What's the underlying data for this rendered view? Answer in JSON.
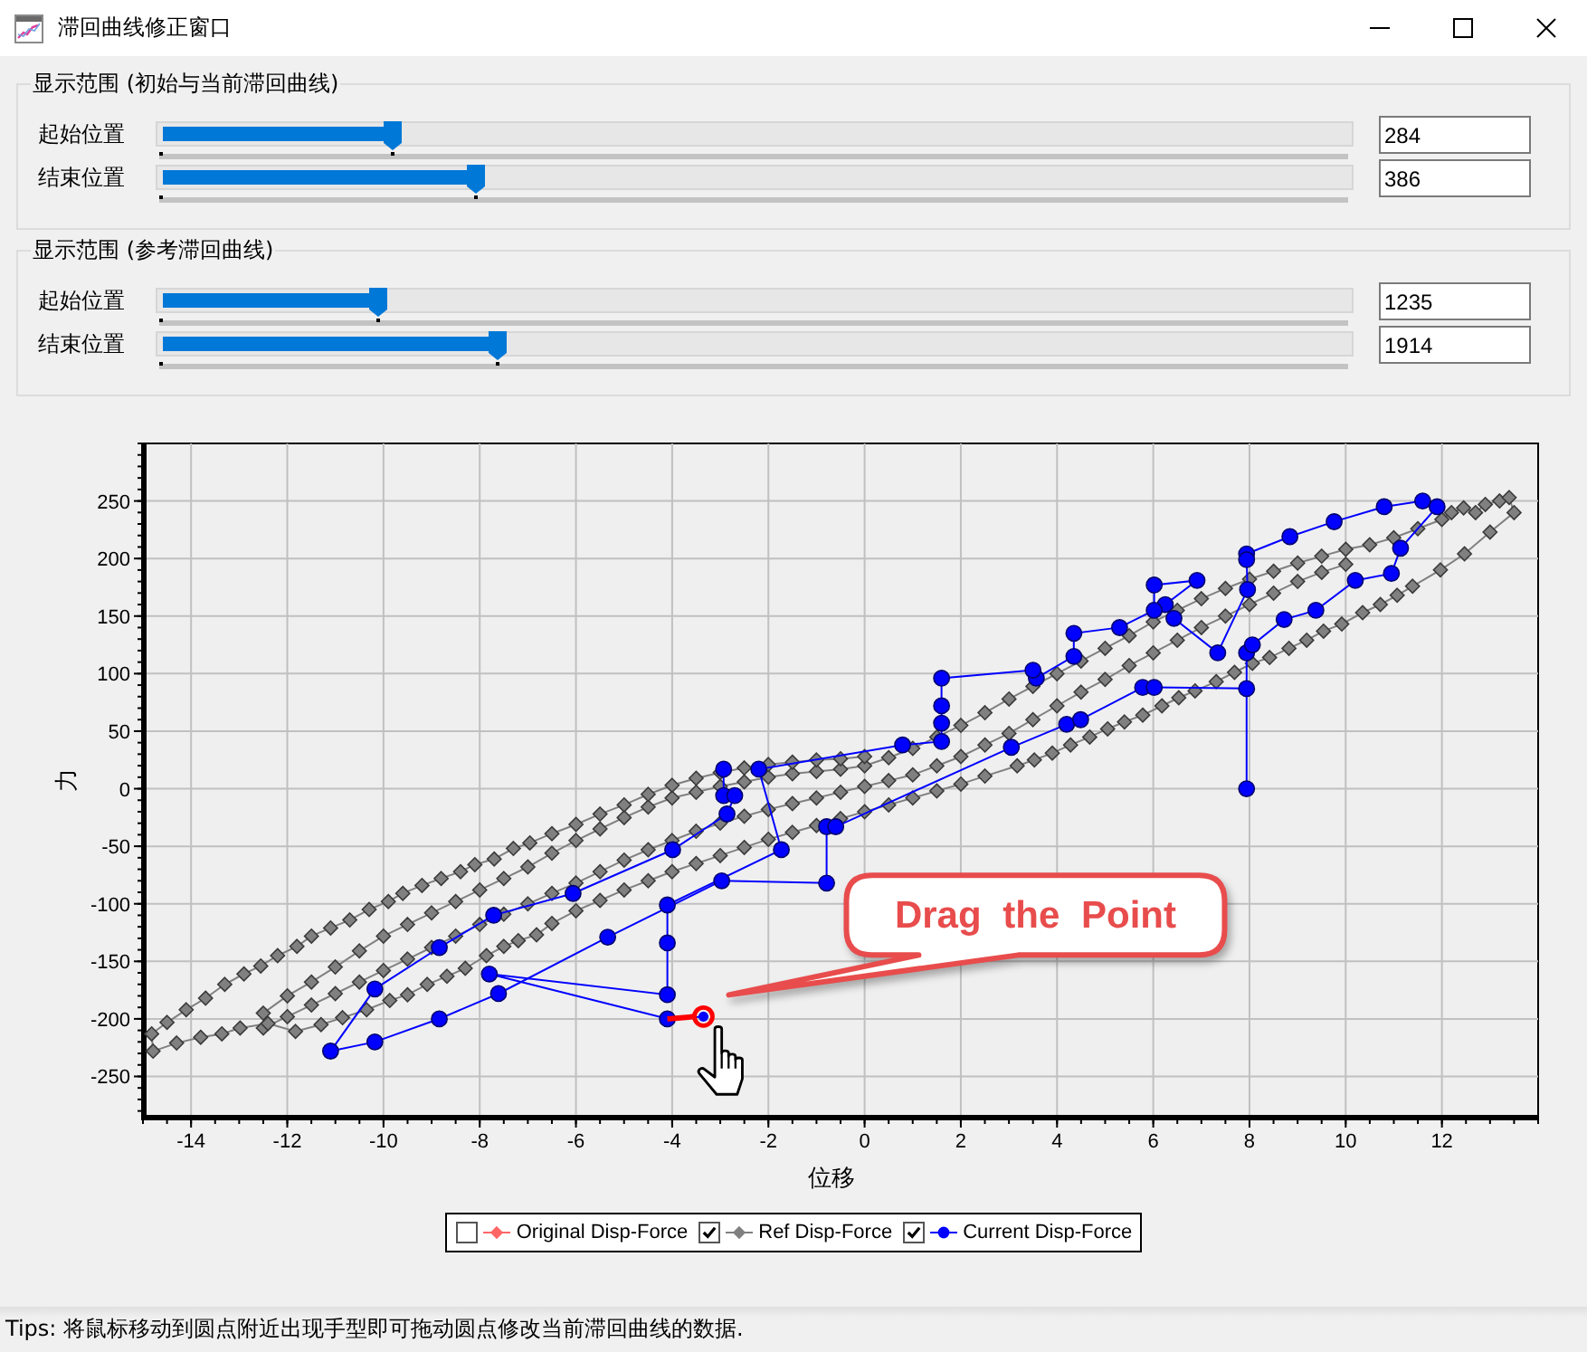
{
  "window": {
    "title": "滞回曲线修正窗口"
  },
  "range_groups": [
    {
      "title": "显示范围 (初始与当前滞回曲线)",
      "sliders": [
        {
          "label": "起始位置",
          "level": 0.194,
          "value": "284"
        },
        {
          "label": "结束位置",
          "level": 0.265,
          "value": "386"
        }
      ]
    },
    {
      "title": "显示范围 (参考滞回曲线)",
      "sliders": [
        {
          "label": "起始位置",
          "level": 0.182,
          "value": "1235"
        },
        {
          "label": "结束位置",
          "level": 0.283,
          "value": "1914"
        }
      ]
    }
  ],
  "chart": {
    "chart_data": {
      "type": "line",
      "xlabel": "位移",
      "ylabel": "力",
      "grid": true,
      "xlim": [
        -15,
        14
      ],
      "ylim": [
        -285,
        300
      ],
      "xticks": [
        -14,
        -12,
        -10,
        -8,
        -6,
        -4,
        -2,
        0,
        2,
        4,
        6,
        8,
        10,
        12
      ],
      "yticks": [
        -250,
        -200,
        -150,
        -100,
        -50,
        0,
        50,
        100,
        150,
        200,
        250
      ],
      "series": [
        {
          "name": "Original Disp-Force",
          "color": "#ff6666",
          "marker": "diamond"
        },
        {
          "name": "Ref Disp-Force",
          "color": "#808080",
          "marker": "diamond",
          "x": [
            10,
            9.5,
            9,
            8.5,
            8,
            7.5,
            7,
            6.5,
            6,
            5.5,
            5,
            4.5,
            4,
            3.5,
            3,
            2.5,
            2,
            1.5,
            1,
            0.5,
            0,
            -0.5,
            -1,
            -1.5,
            -2,
            -2.5,
            -3,
            -3.5,
            -4,
            -4.5,
            -5,
            -5.5,
            -6,
            -6.5,
            -7,
            -7.5,
            -8,
            -8.5,
            -9,
            -9.5,
            -10,
            -10.5,
            -11,
            -11.5,
            -12,
            -12.5,
            -12.5,
            -12,
            -11.5,
            -11,
            -10.5,
            -10,
            -9.5,
            -9,
            -8.5,
            -8,
            -7.5,
            -7,
            -6.5,
            -6,
            -5.5,
            -5,
            -4.5,
            -4,
            -3.5,
            -3,
            -2.5,
            -2,
            -1.5,
            -1,
            -0.5,
            0,
            0.5,
            1,
            1.5,
            2,
            2.5,
            3,
            3.5,
            4,
            4.5,
            5,
            5.5,
            6,
            6.5,
            7,
            7.5,
            8,
            8.5,
            9,
            9.5,
            10,
            10.5,
            11,
            11.5,
            12,
            12.2,
            12.45,
            12.7,
            12.9,
            13.2,
            13.4,
            13.5,
            13,
            12.47,
            11.97,
            11.39,
            11.07,
            10.72,
            10.35,
            9.92,
            9.54,
            9.19,
            8.82,
            8.42,
            8.06,
            7.69,
            7.31,
            6.87,
            6.53,
            6.18,
            5.78,
            5.4,
            5.05,
            4.68,
            4.28,
            3.9,
            3.53,
            3.17,
            2.5,
            2,
            1.5,
            1,
            0.5,
            0,
            -0.5,
            -1,
            -1.5,
            -2,
            -2.5,
            -3,
            -3.5,
            -4,
            -4.5,
            -5,
            -5.5,
            -6,
            -6.5,
            -6.82,
            -7.2,
            -7.5,
            -7.86,
            -8.3,
            -8.68,
            -9.09,
            -9.5,
            -9.87,
            -10.35,
            -10.85,
            -11.3,
            -11.83,
            -12.4,
            -12.98,
            -13.36,
            -13.8,
            -14.3,
            -14.79,
            -14.82,
            -14.5,
            -14.1,
            -13.7,
            -13.3,
            -12.9,
            -12.55,
            -12.2,
            -11.8,
            -11.5,
            -11.1,
            -10.7,
            -10.3,
            -9.9,
            -9.6,
            -9.2,
            -8.8,
            -8.4,
            -8.1,
            -7.7,
            -7.3,
            -6.96,
            -6.5,
            -6,
            -5.5,
            -5,
            -4.5,
            -4,
            -3.5,
            -3,
            -2.5,
            -2,
            -1.5,
            -1,
            -0.5,
            0
          ],
          "values": [
            195,
            188,
            180,
            170,
            160,
            150,
            140,
            129,
            118,
            107,
            95,
            84,
            72,
            60,
            48,
            38,
            28,
            20,
            12,
            7,
            2,
            -3,
            -8,
            -13,
            -18,
            -24,
            -30,
            -37,
            -45,
            -53,
            -62,
            -72,
            -82,
            -91,
            -100,
            -109,
            -118,
            -128,
            -138,
            -148,
            -158,
            -168,
            -178,
            -188,
            -198,
            -208,
            -195,
            -180,
            -168,
            -155,
            -141,
            -128,
            -118,
            -108,
            -98,
            -88,
            -78,
            -68,
            -56,
            -45,
            -35,
            -25,
            -16,
            -8,
            -3,
            2,
            6,
            10,
            13,
            15,
            17,
            20,
            27,
            35,
            45,
            55,
            66,
            78,
            89,
            100,
            111,
            122,
            133,
            145,
            155,
            165,
            174,
            182,
            189,
            196,
            202,
            208,
            212,
            218,
            226,
            234,
            240,
            244,
            240,
            247,
            250,
            253,
            240,
            223,
            204,
            190,
            176,
            168,
            160,
            153,
            143,
            137,
            129,
            122,
            114,
            109,
            101,
            93,
            85,
            79,
            72,
            64,
            58,
            52,
            45,
            38,
            31,
            25,
            20,
            11,
            4,
            -2,
            -8,
            -14,
            -20,
            -26,
            -32,
            -38,
            -44,
            -51,
            -58,
            -65,
            -72,
            -80,
            -88,
            -97,
            -106,
            -117,
            -127,
            -132,
            -137,
            -145,
            -156,
            -163,
            -170,
            -179,
            -184,
            -192,
            -199,
            -205,
            -211,
            -204,
            -208,
            -213,
            -216,
            -221,
            -228,
            -213,
            -203,
            -192,
            -182,
            -170,
            -161,
            -154,
            -145,
            -137,
            -128,
            -121,
            -114,
            -105,
            -98,
            -91,
            -84,
            -78,
            -72,
            -66,
            -61,
            -52,
            -47,
            -39,
            -31,
            -22,
            -14,
            -5,
            3,
            9,
            14,
            18,
            21,
            23,
            25,
            26,
            28
          ]
        },
        {
          "name": "Current Disp-Force",
          "color": "#0000ff",
          "marker": "circle",
          "x": [
            -2.93,
            -2.93,
            -2.7,
            -2.86,
            -3.99,
            -6.06,
            -7.71,
            -8.84,
            -10.18,
            -11.1,
            -10.18,
            -8.84,
            -7.61,
            -5.34,
            -2.97,
            -0.79,
            -0.79,
            -0.6,
            3.05,
            4.2,
            4.49,
            5.78,
            6.02,
            7.94,
            7.94,
            7.94,
            8.06,
            8.72,
            9.38,
            10.2,
            10.95,
            11.14,
            11.9,
            11.6,
            10.8,
            9.76,
            8.84,
            7.94,
            7.94,
            7.96,
            7.34,
            6.43,
            6.25,
            6.91,
            6.02,
            6.02,
            5.3,
            4.35,
            4.35,
            3.57,
            3.5,
            1.6,
            1.6,
            1.6,
            1.6,
            0.79,
            -2.2,
            -1.73,
            -4.1,
            -4.1,
            -4.1,
            -7.8,
            -4.1,
            -3.35
          ],
          "values": [
            17,
            -6,
            -6,
            -22,
            -53,
            -91,
            -110,
            -138,
            -174,
            -228,
            -220,
            -200,
            -178,
            -129,
            -80,
            -82,
            -33,
            -33,
            36,
            56,
            60,
            88,
            88,
            87,
            0,
            118,
            125,
            147,
            155,
            181,
            187,
            209,
            245,
            250,
            245,
            232,
            219,
            204,
            199,
            173,
            118,
            148,
            160,
            181,
            177,
            155,
            140,
            135,
            115,
            96,
            103,
            96,
            72,
            57,
            41,
            38,
            17,
            -53,
            -101,
            -134,
            -179,
            -161,
            -200,
            -198
          ]
        }
      ]
    },
    "legend": [
      {
        "checked": false
      },
      {
        "checked": true
      },
      {
        "checked": true
      }
    ],
    "drag_highlight": true,
    "callout": {
      "text": "Drag the Point"
    }
  },
  "status_bar": {
    "text": "Tips: 将鼠标移动到圆点附近出现手型即可拖动圆点修改当前滞回曲线的数据."
  }
}
